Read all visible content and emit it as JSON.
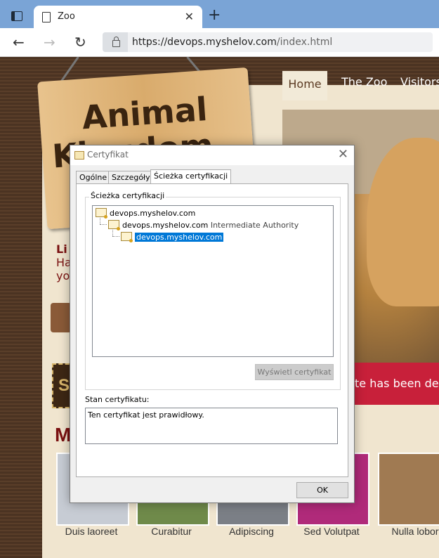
{
  "browser": {
    "tab_title": "Zoo",
    "url_host": "https://devops.myshelov.com",
    "url_path": "/index.html"
  },
  "site": {
    "logo_line1": "Animal",
    "logo_line2": "Kingdom",
    "nav": [
      "Home",
      "The Zoo",
      "Visitors"
    ],
    "left_title": "Li",
    "left_text1": "Ha",
    "left_text2": "yo",
    "s_box": "S",
    "banner_text": "te has been de",
    "section_title": "M",
    "thumbs": [
      "Duis laoreet",
      "Curabitur",
      "Adipiscing",
      "Sed Volutpat",
      "Nulla lobortis"
    ]
  },
  "dialog": {
    "title": "Certyfikat",
    "tabs": [
      "Ogólne",
      "Szczegóły",
      "Ścieżka certyfikacji"
    ],
    "group_label": "Ścieżka certyfikacji",
    "tree": [
      {
        "name": "devops.myshelov.com",
        "suffix": ""
      },
      {
        "name": "devops.myshelov.com",
        "suffix": "Intermediate Authority"
      },
      {
        "name": "devops.myshelov.com",
        "suffix": ""
      }
    ],
    "view_button": "Wyświetl certyfikat",
    "status_label": "Stan certyfikatu:",
    "status_text": "Ten certyfikat jest prawidłowy.",
    "ok_button": "OK"
  },
  "colors": {
    "accent": "#0078d7",
    "tabbar": "#7aa4d6",
    "banner": "#c8203a"
  }
}
